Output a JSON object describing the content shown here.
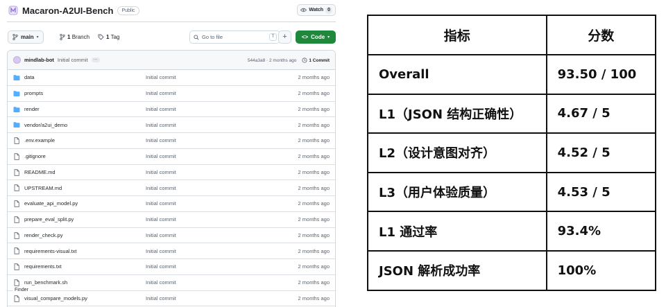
{
  "repo": {
    "name": "Macaron-A2UI-Bench",
    "visibility": "Public",
    "watch_label": "Watch",
    "watch_count": "0"
  },
  "toolbar": {
    "branch": "main",
    "branches_count": "1",
    "branches_label": "Branch",
    "tags_count": "1",
    "tags_label": "Tag",
    "goto_placeholder": "Go to file",
    "goto_shortcut": "T",
    "add_label": "+",
    "code_label": "Code"
  },
  "commit": {
    "author": "mindlab-bot",
    "message": "Initial commit",
    "hash_age": "544a3a8 · 2 months ago",
    "count": "1 Commit"
  },
  "files": [
    {
      "name": "data",
      "type": "folder",
      "message": "Initial commit",
      "age": "2 months ago"
    },
    {
      "name": "prompts",
      "type": "folder",
      "message": "Initial commit",
      "age": "2 months ago"
    },
    {
      "name": "render",
      "type": "folder",
      "message": "Initial commit",
      "age": "2 months ago"
    },
    {
      "name": "vendor/a2ui_demo",
      "type": "folder",
      "message": "Initial commit",
      "age": "2 months ago"
    },
    {
      "name": ".env.example",
      "type": "file",
      "message": "Initial commit",
      "age": "2 months ago"
    },
    {
      "name": ".gitignore",
      "type": "file",
      "message": "Initial commit",
      "age": "2 months ago"
    },
    {
      "name": "README.md",
      "type": "file",
      "message": "Initial commit",
      "age": "2 months ago"
    },
    {
      "name": "UPSTREAM.md",
      "type": "file",
      "message": "Initial commit",
      "age": "2 months ago"
    },
    {
      "name": "evaluate_api_model.py",
      "type": "file",
      "message": "Initial commit",
      "age": "2 months ago"
    },
    {
      "name": "prepare_eval_split.py",
      "type": "file",
      "message": "Initial commit",
      "age": "2 months ago"
    },
    {
      "name": "render_check.py",
      "type": "file",
      "message": "Initial commit",
      "age": "2 months ago"
    },
    {
      "name": "requirements-visual.txt",
      "type": "file",
      "message": "Initial commit",
      "age": "2 months ago"
    },
    {
      "name": "requirements.txt",
      "type": "file",
      "message": "Initial commit",
      "age": "2 months ago"
    },
    {
      "name": "run_benchmark.sh",
      "type": "file",
      "message": "Initial commit",
      "age": "2 months ago"
    },
    {
      "name": "visual_compare_models.py",
      "type": "file",
      "message": "Initial commit",
      "age": "2 months ago"
    }
  ],
  "finder_tooltip": "Finder",
  "metrics_table": {
    "header": [
      "指标",
      "分数"
    ],
    "rows": [
      [
        "Overall",
        "93.50 / 100"
      ],
      [
        "L1（JSON 结构正确性）",
        "4.67 / 5"
      ],
      [
        "L2（设计意图对齐）",
        "4.52 / 5"
      ],
      [
        "L3（用户体验质量）",
        "4.53 / 5"
      ],
      [
        "L1 通过率",
        "93.4%"
      ],
      [
        "JSON 解析成功率",
        "100%"
      ]
    ]
  },
  "colors": {
    "code_button": "#1f883d",
    "folder_icon": "#54aeff",
    "border": "#d1d9e0",
    "muted_text": "#59636e"
  }
}
